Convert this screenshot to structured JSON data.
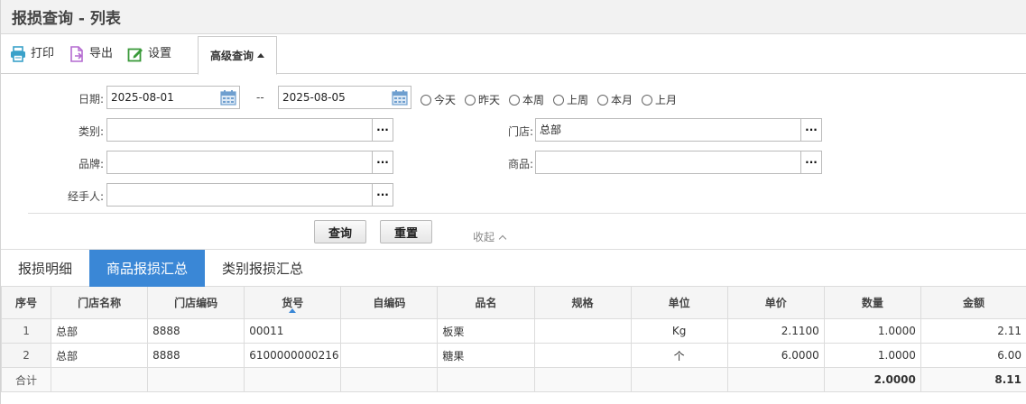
{
  "title": "报损查询 - 列表",
  "toolbar": {
    "print": "打印",
    "export": "导出",
    "settings": "设置",
    "advanced": "高级查询"
  },
  "filters": {
    "date_label": "日期:",
    "date_from": "2025-08-01",
    "date_sep": "--",
    "date_to": "2025-08-05",
    "ranges": [
      "今天",
      "昨天",
      "本周",
      "上周",
      "本月",
      "上月"
    ],
    "category_label": "类别:",
    "category_value": "",
    "store_label": "门店:",
    "store_value": "总部",
    "brand_label": "品牌:",
    "brand_value": "",
    "product_label": "商品:",
    "product_value": "",
    "handler_label": "经手人:",
    "handler_value": "",
    "picker_glyph": "···",
    "query_button": "查询",
    "reset_button": "重置",
    "collapse": "收起"
  },
  "tabs": [
    "报损明细",
    "商品报损汇总",
    "类别报损汇总"
  ],
  "active_tab": 1,
  "grid": {
    "columns": [
      "序号",
      "门店名称",
      "门店编码",
      "货号",
      "自编码",
      "品名",
      "规格",
      "单位",
      "单价",
      "数量",
      "金额"
    ],
    "rows": [
      [
        "1",
        "总部",
        "8888",
        "00011",
        "",
        "板栗",
        "",
        "Kg",
        "2.1100",
        "1.0000",
        "2.11"
      ],
      [
        "2",
        "总部",
        "8888",
        "6100000000216",
        "",
        "糖果",
        "",
        "个",
        "6.0000",
        "1.0000",
        "6.00"
      ]
    ],
    "total": [
      "合计",
      "",
      "",
      "",
      "",
      "",
      "",
      "",
      "",
      "2.0000",
      "8.11"
    ]
  },
  "colors": {
    "accent": "#3a87d6",
    "print_icon": "#3aa1c9",
    "export_icon": "#b46ad0",
    "settings_icon": "#3a9a3a",
    "calendar_icon": "#6f9fcf"
  },
  "icons": [
    "printer-icon",
    "export-file-icon",
    "edit-settings-icon",
    "calendar-icon"
  ]
}
